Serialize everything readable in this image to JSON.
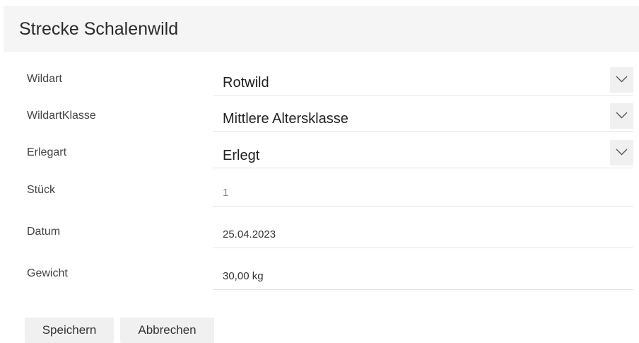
{
  "header": {
    "title": "Strecke Schalenwild"
  },
  "form": {
    "wildart": {
      "label": "Wildart",
      "value": "Rotwild"
    },
    "wildartklasse": {
      "label": "WildartKlasse",
      "value": "Mittlere Altersklasse"
    },
    "erlegart": {
      "label": "Erlegart",
      "value": "Erlegt"
    },
    "stueck": {
      "label": "Stück",
      "value": "1"
    },
    "datum": {
      "label": "Datum",
      "value": "25.04.2023"
    },
    "gewicht": {
      "label": "Gewicht",
      "value": "30,00 kg"
    }
  },
  "buttons": {
    "save_label": "Speichern",
    "cancel_label": "Abbrechen"
  },
  "icons": {
    "dropdown": "chevron-down-icon"
  }
}
